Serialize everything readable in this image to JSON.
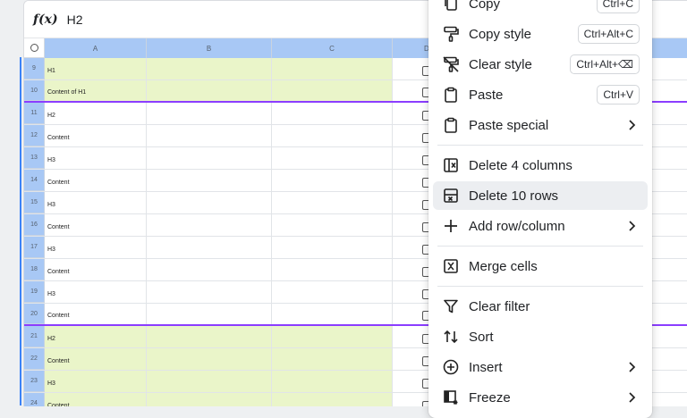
{
  "formula_bar": {
    "fx_label": "f(x)",
    "value": "H2"
  },
  "columns": [
    "A",
    "B",
    "C",
    "D"
  ],
  "rows": [
    {
      "num": "9",
      "a": "H1",
      "highlight": true,
      "purple": false
    },
    {
      "num": "10",
      "a": "Content of H1",
      "highlight": true,
      "purple": true
    },
    {
      "num": "11",
      "a": "H2",
      "highlight": false,
      "purple": false
    },
    {
      "num": "12",
      "a": "Content",
      "highlight": false,
      "purple": false
    },
    {
      "num": "13",
      "a": "H3",
      "highlight": false,
      "purple": false
    },
    {
      "num": "14",
      "a": "Content",
      "highlight": false,
      "purple": false
    },
    {
      "num": "15",
      "a": "H3",
      "highlight": false,
      "purple": false
    },
    {
      "num": "16",
      "a": "Content",
      "highlight": false,
      "purple": false
    },
    {
      "num": "17",
      "a": "H3",
      "highlight": false,
      "purple": false
    },
    {
      "num": "18",
      "a": "Content",
      "highlight": false,
      "purple": false
    },
    {
      "num": "19",
      "a": "H3",
      "highlight": false,
      "purple": false
    },
    {
      "num": "20",
      "a": "Content",
      "highlight": false,
      "purple": true
    },
    {
      "num": "21",
      "a": "H2",
      "highlight": true,
      "purple": false
    },
    {
      "num": "22",
      "a": "Content",
      "highlight": true,
      "purple": false
    },
    {
      "num": "23",
      "a": "H3",
      "highlight": true,
      "purple": false
    },
    {
      "num": "24",
      "a": "Content",
      "highlight": true,
      "purple": false
    }
  ],
  "menu": {
    "copy": {
      "label": "Copy",
      "shortcut": "Ctrl+C"
    },
    "copy_style": {
      "label": "Copy style",
      "shortcut": "Ctrl+Alt+C"
    },
    "clear_style": {
      "label": "Clear style",
      "shortcut": "Ctrl+Alt+⌫"
    },
    "paste": {
      "label": "Paste",
      "shortcut": "Ctrl+V"
    },
    "paste_special": {
      "label": "Paste special"
    },
    "delete_columns": {
      "label": "Delete 4 columns"
    },
    "delete_rows": {
      "label": "Delete 10 rows"
    },
    "add_row_column": {
      "label": "Add row/column"
    },
    "merge_cells": {
      "label": "Merge cells"
    },
    "clear_filter": {
      "label": "Clear filter"
    },
    "sort": {
      "label": "Sort"
    },
    "insert": {
      "label": "Insert"
    },
    "freeze": {
      "label": "Freeze"
    }
  },
  "colors": {
    "accent_purple": "#8b3dff",
    "header_blue": "#a8c8f5",
    "highlight_green": "#eaf5c9"
  }
}
